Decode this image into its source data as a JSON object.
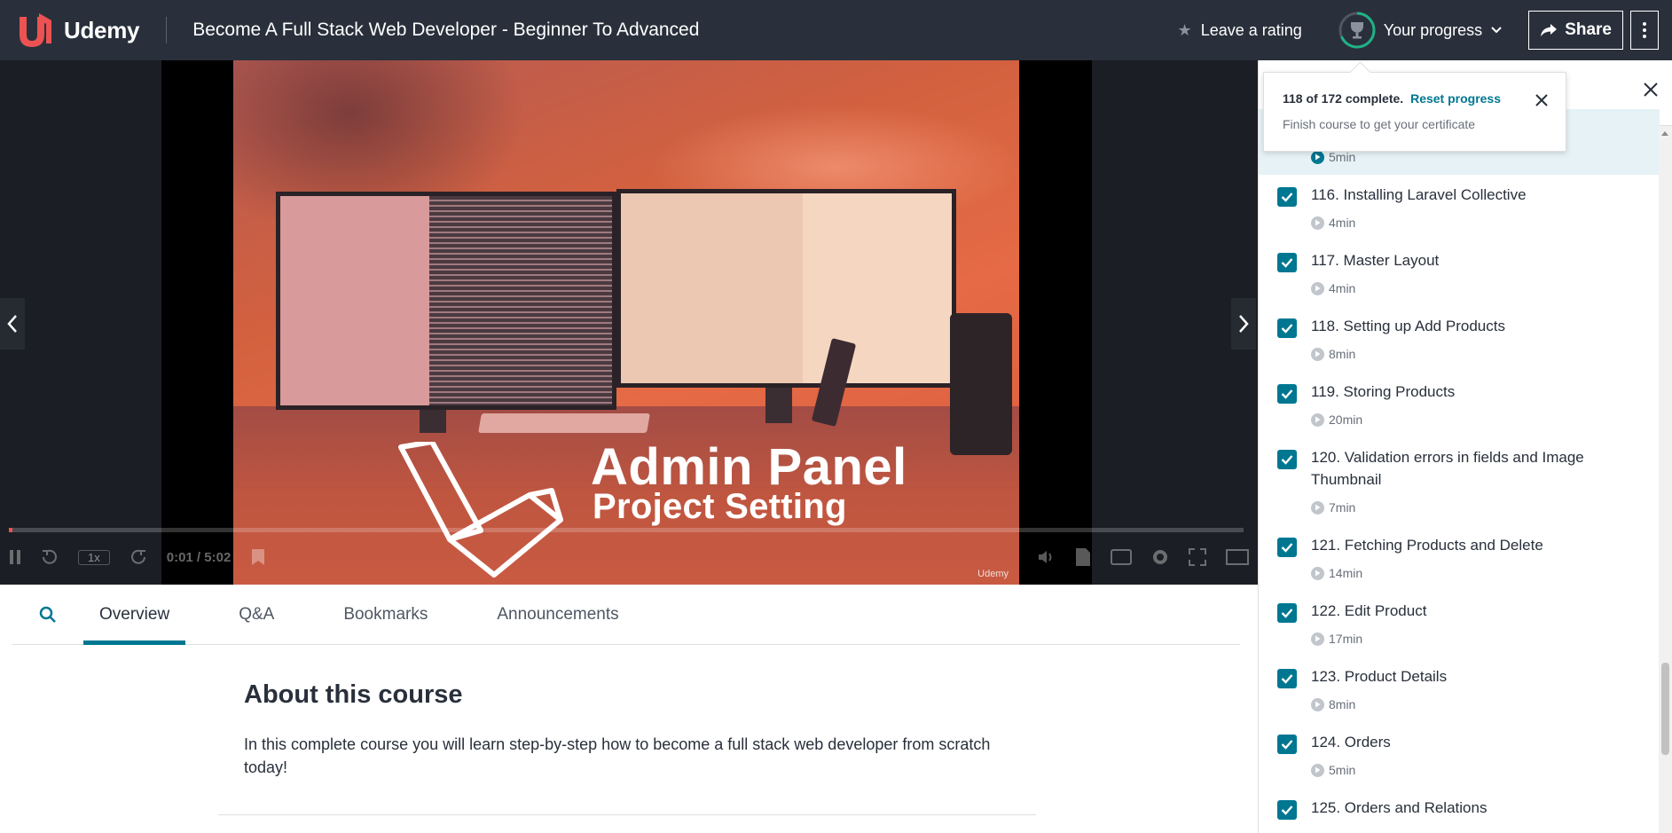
{
  "app": {
    "logo_text": "Udemy"
  },
  "header": {
    "course_title": "Become A Full Stack Web Developer - Beginner To Advanced",
    "rating_label": "Leave a rating",
    "progress_label": "Your progress",
    "share_label": "Share",
    "progress_fraction": 0.686
  },
  "video": {
    "slide_title": "Admin Panel",
    "slide_subtitle": "Project Setting",
    "speed": "1x",
    "time": "0:01 / 5:02",
    "watermark": "Udemy",
    "played_fraction": 0.003
  },
  "tabs": [
    {
      "label": "Overview"
    },
    {
      "label": "Q&A"
    },
    {
      "label": "Bookmarks"
    },
    {
      "label": "Announcements"
    }
  ],
  "overview": {
    "title": "About this course",
    "description": "In this complete course you will learn step-by-step how to become a full stack web developer from scratch today!"
  },
  "popover": {
    "status": "118 of 172 complete.",
    "reset_label": "Reset progress",
    "subtitle": "Finish course to get your certificate"
  },
  "lectures": [
    {
      "title": "",
      "duration": "5min",
      "current": true
    },
    {
      "title": "116. Installing Laravel Collective",
      "duration": "4min"
    },
    {
      "title": "117. Master Layout",
      "duration": "4min"
    },
    {
      "title": "118. Setting up Add Products",
      "duration": "8min"
    },
    {
      "title": "119. Storing Products",
      "duration": "20min"
    },
    {
      "title": "120. Validation errors in fields and Image Thumbnail",
      "duration": "7min"
    },
    {
      "title": "121. Fetching Products and Delete",
      "duration": "14min"
    },
    {
      "title": "122. Edit Product",
      "duration": "17min"
    },
    {
      "title": "123. Product Details",
      "duration": "8min"
    },
    {
      "title": "124. Orders",
      "duration": "5min"
    },
    {
      "title": "125. Orders and Relations",
      "duration": ""
    }
  ],
  "colors": {
    "header_bg": "#29303b",
    "accent": "#007791",
    "brand_red": "#ec5252"
  }
}
